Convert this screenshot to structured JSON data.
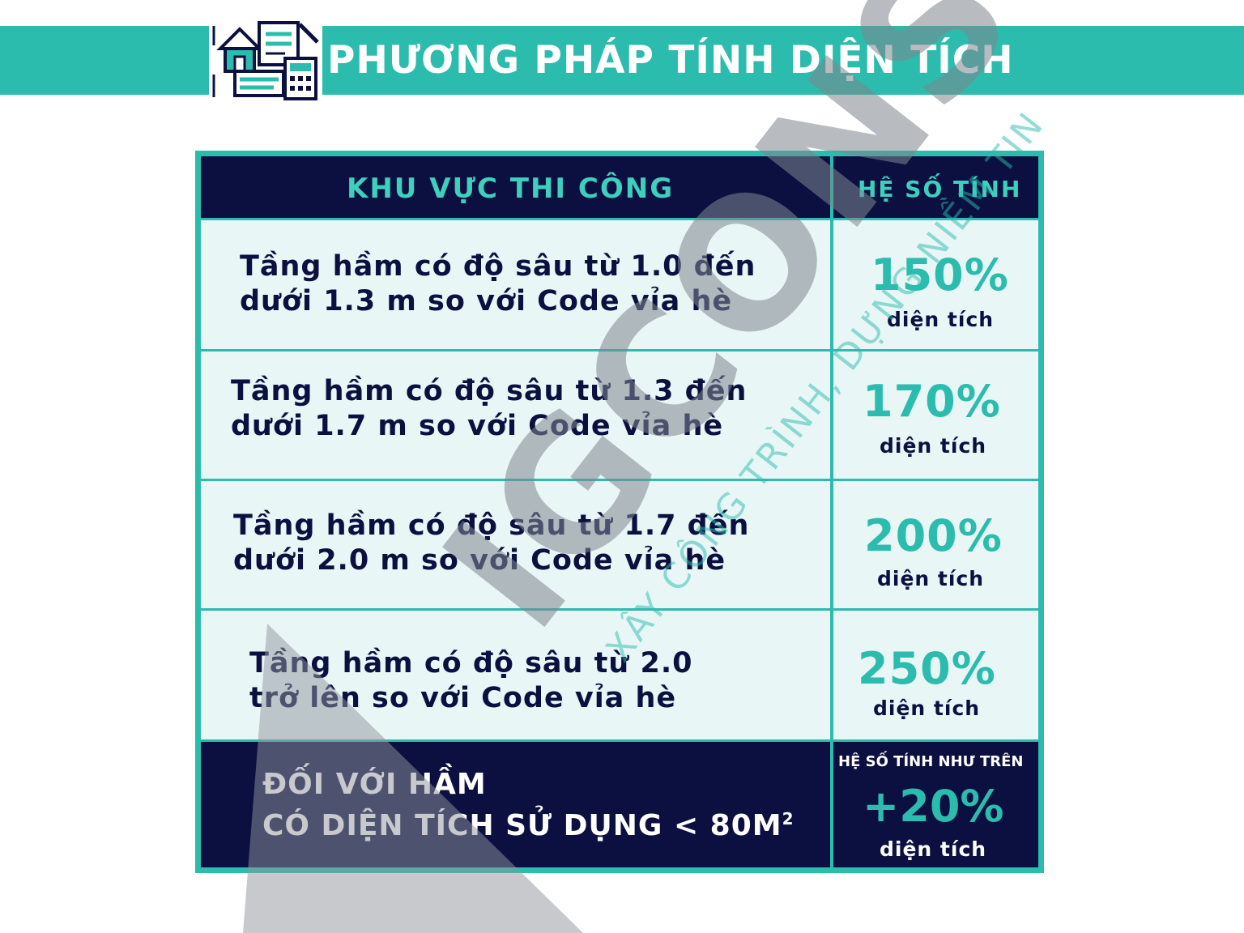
{
  "header": {
    "title": "PHƯƠNG PHÁP TÍNH DIỆN TÍCH",
    "icon": "house-plan-calculator-icon",
    "brand_color": "#2bbcad"
  },
  "table": {
    "col_area": "KHU VỰC THI CÔNG",
    "col_coef": "HỆ SỐ TÍNH",
    "rows": [
      {
        "line1": "Tầng hầm có độ sâu từ 1.0 đến",
        "line2": "dưới 1.3 m so với Code vỉa hè",
        "percent": "150%",
        "unit": "diện tích"
      },
      {
        "line1": "Tầng hầm có độ sâu từ 1.3 đến",
        "line2": "dưới 1.7 m so với Code vỉa hè",
        "percent": "170%",
        "unit": "diện tích"
      },
      {
        "line1": "Tầng hầm có độ sâu từ 1.7 đến",
        "line2": "dưới 2.0 m so với Code vỉa hè",
        "percent": "200%",
        "unit": "diện tích"
      },
      {
        "line1": "Tầng hầm có độ sâu từ 2.0",
        "line2": "trở lên so với Code vỉa hè",
        "percent": "250%",
        "unit": "diện tích"
      }
    ],
    "footer": {
      "line1": "ĐỐI VỚI HẦM",
      "line2": "CÓ DIỆN TÍCH SỬ DỤNG < 80M",
      "superscript": "2",
      "note": "HỆ SỐ TÍNH NHƯ TRÊN",
      "percent": "+20%",
      "unit": "diện tích"
    }
  },
  "watermark": {
    "logo": "IGCONS",
    "slogan": "XÂY CÔNG TRÌNH, DỰNG NIỀM TIN"
  }
}
